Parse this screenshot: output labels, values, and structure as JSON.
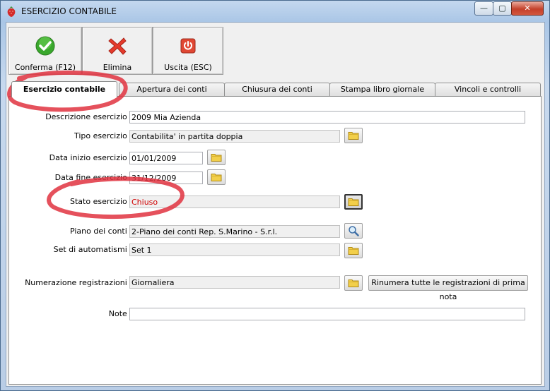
{
  "window": {
    "title": "ESERCIZIO CONTABILE",
    "min_glyph": "—",
    "max_glyph": "▢",
    "close_glyph": "✕"
  },
  "toolbar": {
    "conferma_label": "Conferma (F12)",
    "elimina_label": "Elimina",
    "uscita_label": "Uscita (ESC)"
  },
  "tabs": [
    {
      "label": "Esercizio contabile"
    },
    {
      "label": "Apertura dei conti"
    },
    {
      "label": "Chiusura dei conti"
    },
    {
      "label": "Stampa libro giornale"
    },
    {
      "label": "Vincoli e controlli"
    }
  ],
  "form": {
    "descrizione": {
      "label": "Descrizione esercizio :",
      "value": "2009 Mia Azienda"
    },
    "tipo": {
      "label": "Tipo esercizio :",
      "value": "Contabilita' in partita doppia"
    },
    "data_inizio": {
      "label": "Data inizio esercizio :",
      "value": "01/01/2009"
    },
    "data_fine": {
      "label": "Data fine esercizio :",
      "value": "31/12/2009"
    },
    "stato": {
      "label": "Stato esercizio :",
      "value": "Chiuso"
    },
    "piano": {
      "label": "Piano dei conti :",
      "value": "2-Piano dei conti Rep. S.Marino - S.r.l."
    },
    "set": {
      "label": "Set di automatismi :",
      "value": "Set 1"
    },
    "numerazione": {
      "label": "Numerazione registrazioni :",
      "value": "Giornaliera",
      "rinumera_label": "Rinumera tutte le registrazioni di prima nota"
    },
    "note": {
      "label": "Note :",
      "value": ""
    }
  },
  "colors": {
    "highlight_ring": "#e0323f",
    "status_red": "#d00000"
  },
  "icons": {
    "conferma": "check-icon",
    "elimina": "red-x-icon",
    "uscita": "power-icon",
    "folder": "folder-icon",
    "search": "magnifier-icon"
  }
}
